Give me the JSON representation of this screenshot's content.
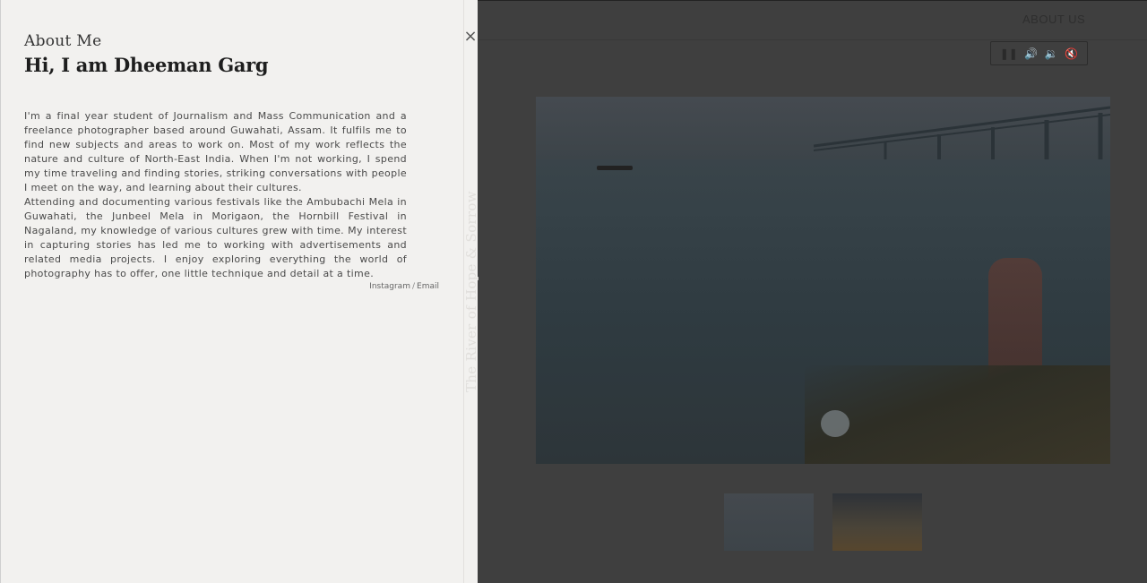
{
  "background": {
    "nav": {
      "about_label": "ABOUT US"
    },
    "audio_controls": [
      {
        "icon": "pause-icon",
        "glyph": "❚❚"
      },
      {
        "icon": "volume-up-icon",
        "glyph": "🔊"
      },
      {
        "icon": "volume-down-icon",
        "glyph": "🔉"
      },
      {
        "icon": "mute-icon",
        "glyph": "🔇"
      }
    ]
  },
  "about_panel": {
    "label": "About Me",
    "heading": "Hi, I am Dheeman Garg",
    "paragraphs": [
      "I'm a final year student of Journalism and Mass Communication and a freelance photographer based around Guwahati, Assam. It fulfils me to find new subjects and areas to work on. Most of my work reflects the nature and culture of North-East India. When I'm not working, I spend my time traveling and finding stories, striking conversations with people I meet on the way, and learning about their cultures.",
      "Attending and documenting various festivals like the Ambubachi Mela in Guwahati, the Junbeel Mela in Morigaon, the Hornbill Festival in Nagaland, my knowledge of various cultures grew with time. My interest in capturing stories has led me to working with advertisements and related media projects. I enjoy exploring everything the world of photography has to offer, one little technique and detail at a time."
    ],
    "links": {
      "instagram": "Instagram",
      "separator": "/",
      "email": "Email"
    },
    "close_glyph": "×",
    "vertical_title": "The River of Hope & Sorrow"
  },
  "colors": {
    "panel_bg": "#f2f1ef",
    "overlay": "#3f3f3f"
  }
}
